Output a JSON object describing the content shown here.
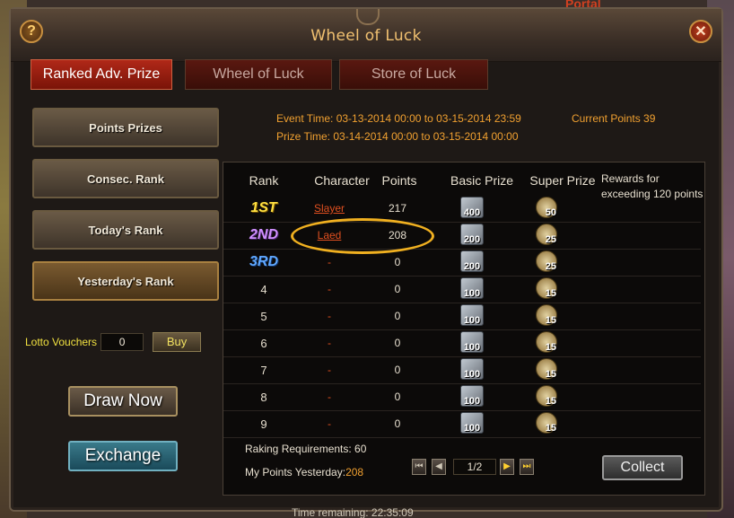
{
  "background": {
    "portal_text": "Portal",
    "bottom_text": "Time remaining: 22:35:09"
  },
  "window": {
    "title": "Wheel of Luck",
    "help_label": "?",
    "close_label": "✕"
  },
  "tabs": [
    {
      "label": "Ranked Adv. Prize",
      "active": true
    },
    {
      "label": "Wheel of Luck",
      "active": false
    },
    {
      "label": "Store of Luck",
      "active": false
    }
  ],
  "sidebar": {
    "items": [
      {
        "label": "Points Prizes"
      },
      {
        "label": "Consec. Rank"
      },
      {
        "label": "Today's Rank"
      },
      {
        "label": "Yesterday's Rank",
        "selected": true
      }
    ],
    "lotto_label": "Lotto Vouchers",
    "lotto_count": "0",
    "buy_label": "Buy",
    "draw_label": "Draw Now",
    "exchange_label": "Exchange"
  },
  "info": {
    "event_time": "Event Time: 03-13-2014 00:00 to 03-15-2014 23:59",
    "prize_time": "Prize Time: 03-14-2014 00:00 to 03-15-2014 00:00",
    "current_points": "Current Points 39"
  },
  "table": {
    "headers": {
      "rank": "Rank",
      "character": "Character",
      "points": "Points",
      "basic": "Basic Prize",
      "super": "Super Prize"
    },
    "rewards_note": "Rewards for exceeding 120 points",
    "rows": [
      {
        "rank": "1ST",
        "character": "Slayer",
        "points": "217",
        "basic": "400",
        "super": "50"
      },
      {
        "rank": "2ND",
        "character": "Laed",
        "points": "208",
        "basic": "200",
        "super": "25"
      },
      {
        "rank": "3RD",
        "character": "-",
        "points": "0",
        "basic": "200",
        "super": "25"
      },
      {
        "rank": "4",
        "character": "-",
        "points": "0",
        "basic": "100",
        "super": "15"
      },
      {
        "rank": "5",
        "character": "-",
        "points": "0",
        "basic": "100",
        "super": "15"
      },
      {
        "rank": "6",
        "character": "-",
        "points": "0",
        "basic": "100",
        "super": "15"
      },
      {
        "rank": "7",
        "character": "-",
        "points": "0",
        "basic": "100",
        "super": "15"
      },
      {
        "rank": "8",
        "character": "-",
        "points": "0",
        "basic": "100",
        "super": "15"
      },
      {
        "rank": "9",
        "character": "-",
        "points": "0",
        "basic": "100",
        "super": "15"
      }
    ],
    "requirements_label": "Raking Requirements: 60",
    "my_points_label": "My Points Yesterday:",
    "my_points_value": "208",
    "page": "1/2",
    "collect_label": "Collect",
    "pager_icons": [
      "first-page-icon",
      "prev-page-icon",
      "next-page-icon",
      "last-page-icon"
    ]
  },
  "colors": {
    "accent": "#f0a030",
    "tab_active": "#b02818",
    "highlight": "#f0b020"
  }
}
